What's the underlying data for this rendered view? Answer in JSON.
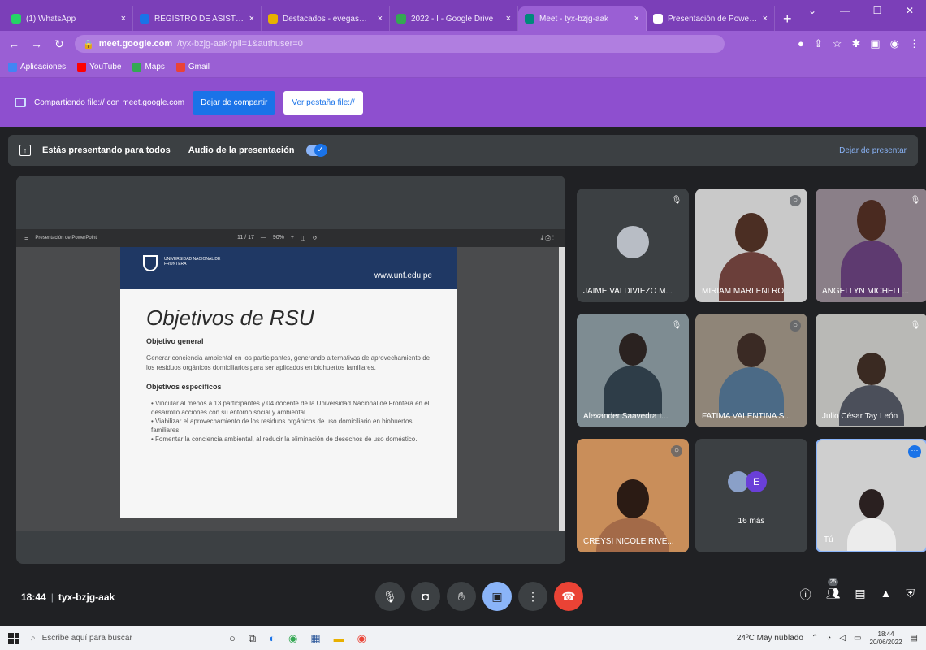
{
  "browser": {
    "tabs": [
      {
        "title": "(1) WhatsApp",
        "color": "#25d366",
        "active": false
      },
      {
        "title": "REGISTRO DE ASISTENTES",
        "color": "#1a73e8",
        "active": false
      },
      {
        "title": "Destacados - evegas@unf.edu.pe",
        "color": "#e8b000",
        "active": false
      },
      {
        "title": "2022 - I - Google Drive",
        "color": "#34a853",
        "active": false
      },
      {
        "title": "Meet - tyx-bzjg-aak",
        "color": "#00897b",
        "active": true
      },
      {
        "title": "Presentación de PowerPoint",
        "color": "#ffffff",
        "active": false
      }
    ],
    "newtab": "+",
    "url_host": "meet.google.com",
    "url_path": "/tyx-bzjg-aak?pli=1&authuser=0",
    "bookmarks": [
      {
        "label": "Aplicaciones",
        "color": "#4285f4"
      },
      {
        "label": "YouTube",
        "color": "#ff0000"
      },
      {
        "label": "Maps",
        "color": "#34a853"
      },
      {
        "label": "Gmail",
        "color": "#ea4335"
      }
    ]
  },
  "sharebar": {
    "text": "Compartiendo file:// con meet.google.com",
    "stop_label": "Dejar de compartir",
    "view_label": "Ver pestaña file://"
  },
  "presbar": {
    "presenting_text": "Estás presentando para todos",
    "audio_text": "Audio de la presentación",
    "stop_label": "Dejar de presentar"
  },
  "ppt": {
    "title": "Presentación de PowerPoint",
    "page": "11 / 17",
    "zoom": "90%"
  },
  "slide": {
    "univ": "UNIVERSIDAD NACIONAL DE FRONTERA",
    "www": "www.unf.edu.pe",
    "title": "Objetivos de RSU",
    "general_heading": "Objetivo general",
    "general_text": "Generar conciencia ambiental en los participantes, generando alternativas de aprovechamiento de los residuos orgánicos domiciliarios para ser aplicados en biohuertos familiares.",
    "specific_heading": "Objetivos específicos",
    "bullets": [
      "Vincular al menos a 13 participantes y 04 docente de la Universidad Nacional de Frontera en el desarrollo acciones con su entorno social y ambiental.",
      "Viabilizar el aprovechamiento de los residuos orgánicos de uso domiciliario en biohuertos familiares.",
      "Fomentar la conciencia ambiental, al reducir la eliminación de desechos de uso doméstico."
    ]
  },
  "participants": [
    {
      "name": "JAIME VALDIVIEZO M...",
      "muted": true
    },
    {
      "name": "MIRIAM MARLENI RO...",
      "muted": true
    },
    {
      "name": "ANGELLYN MICHELL...",
      "muted": true
    },
    {
      "name": "Alexander Saavedra I...",
      "muted": true
    },
    {
      "name": "FATIMA VALENTINA S...",
      "muted": true
    },
    {
      "name": "Julio César Tay León",
      "muted": true
    },
    {
      "name": "CREYSI NICOLE RIVE...",
      "muted": true
    },
    {
      "name": "16 más",
      "initial": "E"
    },
    {
      "name": "Tú"
    }
  ],
  "meeting": {
    "time": "18:44",
    "code": "tyx-bzjg-aak",
    "people_count": "25"
  },
  "taskbar": {
    "search_placeholder": "Escribe aquí para buscar",
    "weather": "24ºC May nublado",
    "clock_time": "18:44",
    "clock_date": "20/06/2022"
  }
}
